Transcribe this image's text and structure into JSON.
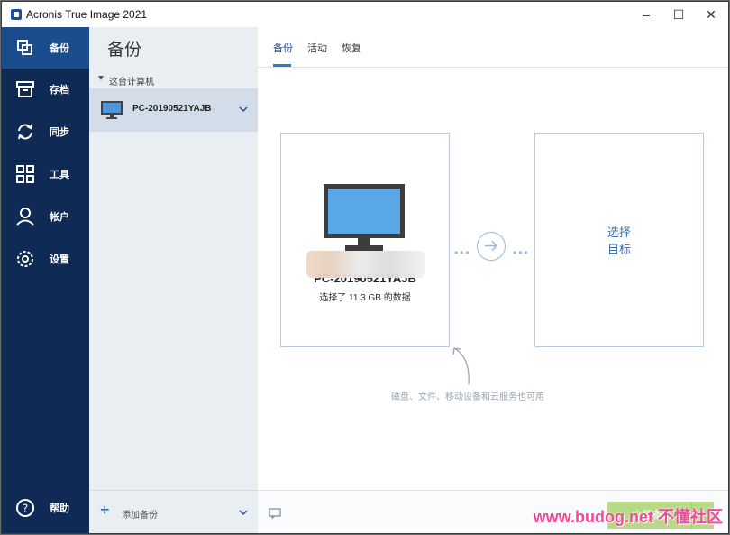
{
  "window": {
    "title": "Acronis True Image 2021"
  },
  "sidebar": {
    "items": [
      {
        "label": "备份",
        "icon": "backup-copy-icon",
        "active": true
      },
      {
        "label": "存档",
        "icon": "archive-box-icon",
        "active": false
      },
      {
        "label": "同步",
        "icon": "sync-arrows-icon",
        "active": false
      },
      {
        "label": "工具",
        "icon": "tools-grid-icon",
        "active": false
      },
      {
        "label": "帐户",
        "icon": "user-icon",
        "active": false
      },
      {
        "label": "设置",
        "icon": "gear-icon",
        "active": false
      }
    ],
    "help": {
      "label": "帮助",
      "icon": "question-circle-icon"
    }
  },
  "panel": {
    "title": "备份",
    "section_label": "这台计算机",
    "device": {
      "name": "PC-20190521YAJB",
      "icon": "monitor-icon"
    },
    "add_backup_label": "添加备份"
  },
  "main": {
    "tabs": [
      {
        "label": "备份",
        "active": true
      },
      {
        "label": "活动",
        "active": false
      },
      {
        "label": "恢复",
        "active": false
      }
    ],
    "source": {
      "name": "PC-20190521YAJB",
      "info": "选择了 11.3 GB 的数据"
    },
    "target": {
      "line1": "选择",
      "line2": "目标"
    },
    "hint": "磁盘、文件、移动设备和云服务也可用",
    "start_button": "立即备份"
  },
  "watermark": "www.budog.net 不懂社区",
  "colors": {
    "sidebar": "#0e2a55",
    "active": "#1b4d8e",
    "accent": "#2a7bd1",
    "start": "#b8d987"
  }
}
